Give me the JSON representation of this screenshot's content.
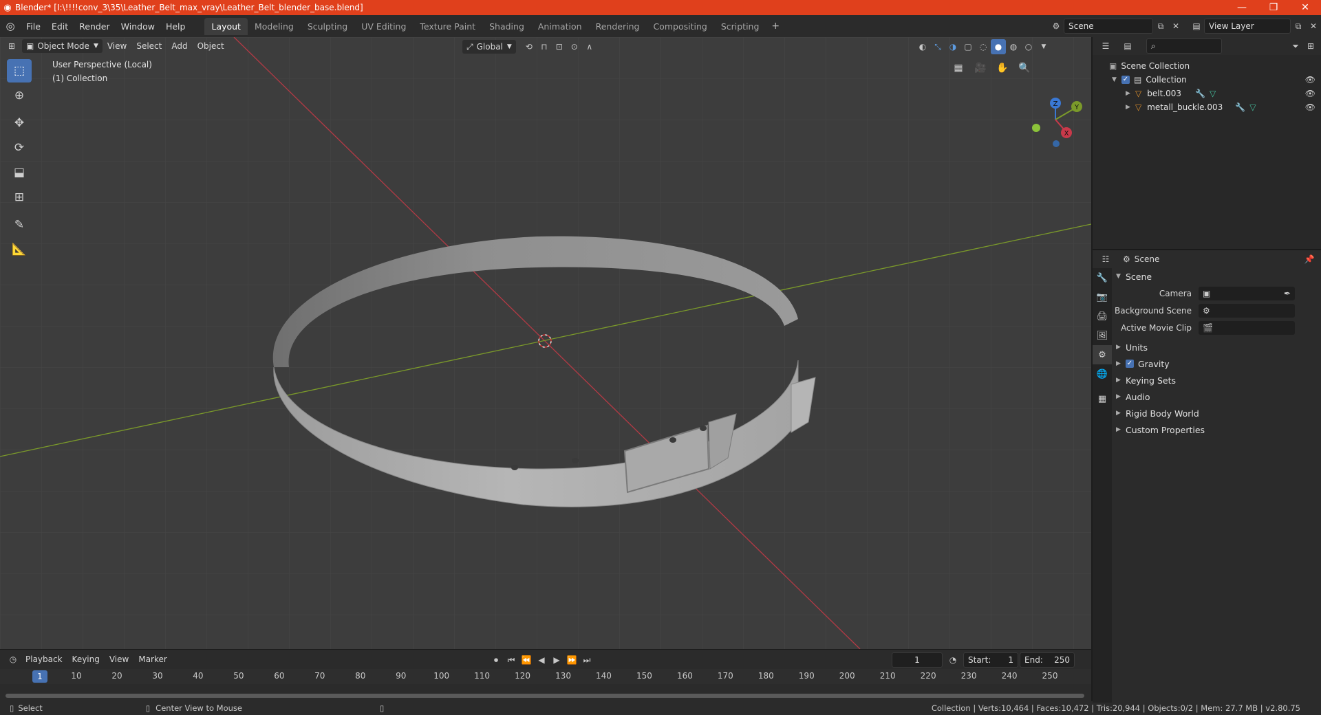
{
  "window": {
    "title": "Blender* [I:\\!!!!conv_3\\35\\Leather_Belt_max_vray\\Leather_Belt_blender_base.blend]",
    "minimize": "—",
    "maximize": "❐",
    "close": "✕"
  },
  "menu": [
    "File",
    "Edit",
    "Render",
    "Window",
    "Help"
  ],
  "workspaces": [
    "Layout",
    "Modeling",
    "Sculpting",
    "UV Editing",
    "Texture Paint",
    "Shading",
    "Animation",
    "Rendering",
    "Compositing",
    "Scripting"
  ],
  "workspace_add": "+",
  "scene_name": "Scene",
  "view_layer_name": "View Layer",
  "viewport": {
    "mode": "Object Mode",
    "menus": [
      "View",
      "Select",
      "Add",
      "Object"
    ],
    "transform_orientation": "Global",
    "perspective_label": "User Perspective (Local)",
    "collection_label": "(1) Collection",
    "gizmo_axes": {
      "z": "Z",
      "y": "Y",
      "x": "X"
    }
  },
  "timeline": {
    "menus": [
      "Playback",
      "Keying",
      "View",
      "Marker"
    ],
    "current_frame": "1",
    "start_label": "Start:",
    "start_value": "1",
    "end_label": "End:",
    "end_value": "250",
    "ruler": [
      "1",
      "10",
      "20",
      "30",
      "40",
      "50",
      "60",
      "70",
      "80",
      "90",
      "100",
      "110",
      "120",
      "130",
      "140",
      "150",
      "160",
      "170",
      "180",
      "190",
      "200",
      "210",
      "220",
      "230",
      "240",
      "250"
    ]
  },
  "statusbar": {
    "select": "Select",
    "center_view": "Center View to Mouse",
    "stats": "Collection | Verts:10,464 | Faces:10,472 | Tris:20,944 | Objects:0/2 | Mem: 27.7 MB | v2.80.75"
  },
  "outliner": {
    "scene_collection": "Scene Collection",
    "collection": "Collection",
    "objects": [
      "belt.003",
      "metall_buckle.003"
    ]
  },
  "properties": {
    "header": "Scene",
    "section": "Scene",
    "camera_label": "Camera",
    "background_scene_label": "Background Scene",
    "active_movie_clip_label": "Active Movie Clip",
    "subsections": [
      "Units",
      "Gravity",
      "Keying Sets",
      "Audio",
      "Rigid Body World",
      "Custom Properties"
    ]
  },
  "colors": {
    "title_bar": "#e0401c",
    "accent": "#4772b3",
    "x_axis": "#c9394a",
    "y_axis": "#7b9a2a",
    "z_axis": "#3a78d4"
  }
}
